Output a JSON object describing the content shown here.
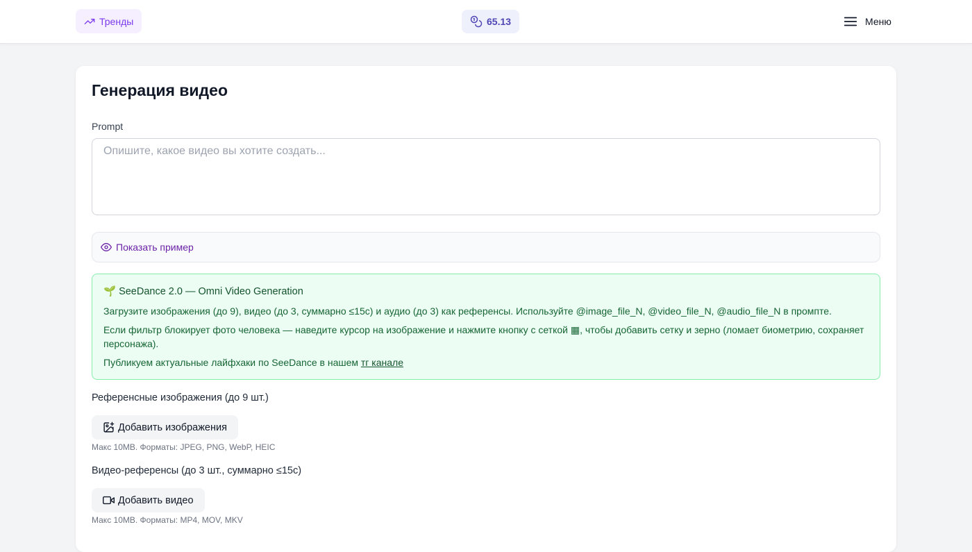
{
  "header": {
    "trends_label": "Тренды",
    "balance_value": "65.13",
    "menu_label": "Меню"
  },
  "main": {
    "title": "Генерация видео",
    "prompt": {
      "label": "Prompt",
      "value": "",
      "placeholder": "Опишите, какое видео вы хотите создать..."
    },
    "show_example_label": "Показать пример",
    "info": {
      "emoji": "🌱",
      "title": "SeeDance 2.0 — Omni Video Generation",
      "line1": "Загрузите изображения (до 9), видео (до 3, суммарно ≤15с) и аудио (до 3) как референсы. Используйте @image_file_N, @video_file_N, @audio_file_N в промпте.",
      "line2": "Если фильтр блокирует фото человека — наведите курсор на изображение и нажмите кнопку с сеткой ▦, чтобы добавить сетку и зерно (ломает биометрию, сохраняет персонажа).",
      "line3_prefix": "Публикуем актуальные лайфхаки по SeeDance в нашем ",
      "line3_link": "тг канале"
    },
    "images": {
      "label": "Референсные изображения (до 9 шт.)",
      "button_label": "Добавить изображения",
      "hint": "Макс 10MB. Форматы: JPEG, PNG, WebP, HEIC"
    },
    "videos": {
      "label": "Видео-референсы (до 3 шт., суммарно ≤15с)",
      "button_label": "Добавить видео",
      "hint": "Макс 10MB. Форматы: MP4, MOV, MKV"
    }
  },
  "colors": {
    "accent": "#7c3aed",
    "balance": "#4f46b5",
    "info_bg": "#ecfdf3",
    "info_border": "#86efac",
    "info_text": "#166534"
  },
  "icons": {
    "trends": "trending-up-icon",
    "balance": "coins-icon",
    "menu": "hamburger-menu-icon",
    "example": "eye-icon",
    "images": "image-plus-icon",
    "videos": "video-camera-icon"
  }
}
